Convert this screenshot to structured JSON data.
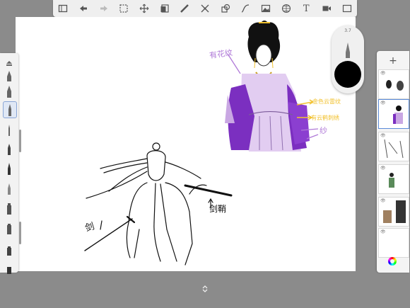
{
  "toolbar": {
    "items": [
      "gallery-icon",
      "undo-icon",
      "redo-icon",
      "selection-icon",
      "transform-icon",
      "layer-icon",
      "ruler-icon",
      "symmetry-icon",
      "shapes-icon",
      "curve-icon",
      "image-icon",
      "perspective-icon",
      "text-icon",
      "video-icon",
      "fullscreen-icon"
    ],
    "text_tool": "T"
  },
  "puck": {
    "size": "3.7",
    "color": "#000000"
  },
  "layers": {
    "add_label": "+"
  },
  "annotations": {
    "pattern": "有花纹",
    "gold_pattern": "金色云雷纹",
    "purple_pattern": "有云鹤刺绣",
    "silk": "纱",
    "sword": "剑",
    "scabbard": "剑鞘"
  },
  "colors": {
    "purple": "#7b2fc0",
    "lavender": "#c9a7e3",
    "gold": "#f2c230",
    "accent": "#5b8bd9"
  }
}
